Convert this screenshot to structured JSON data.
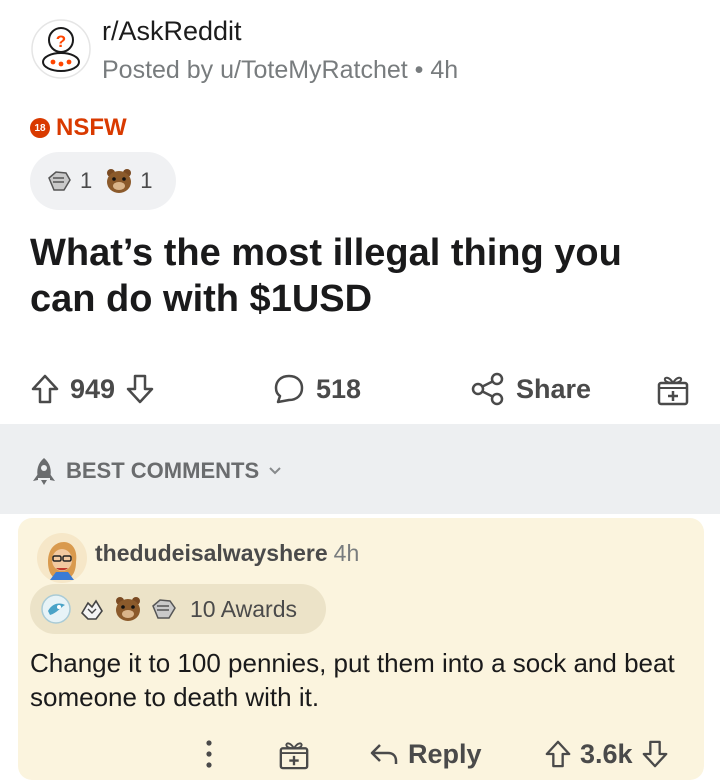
{
  "post": {
    "subreddit": "r/AskReddit",
    "posted_by": "Posted by u/ToteMyRatchet",
    "age": "4h",
    "nsfw_badge": "18",
    "nsfw_label": "NSFW",
    "awards": [
      {
        "icon": "silver-award-icon",
        "count": "1"
      },
      {
        "icon": "bear-award-icon",
        "count": "1"
      }
    ],
    "title": "What’s the most illegal thing you can do with $1USD",
    "upvotes": "949",
    "comments": "518",
    "share_label": "Share"
  },
  "sort": {
    "label": "BEST COMMENTS"
  },
  "comment": {
    "username": "thedudeisalwayshere",
    "age": "4h",
    "awards_label": "10 Awards",
    "award_icons": [
      "rocket-award-icon",
      "hands-award-icon",
      "bear-award-icon",
      "silver-award-icon"
    ],
    "body": "Change it to 100 pennies, put them into a sock and beat someone to death with it.",
    "reply_label": "Reply",
    "score": "3.6k"
  },
  "colors": {
    "nsfw": "#d93a00",
    "comment_highlight": "#fbf4de",
    "section_bar": "#edeff1",
    "muted_text": "#787c7e"
  }
}
